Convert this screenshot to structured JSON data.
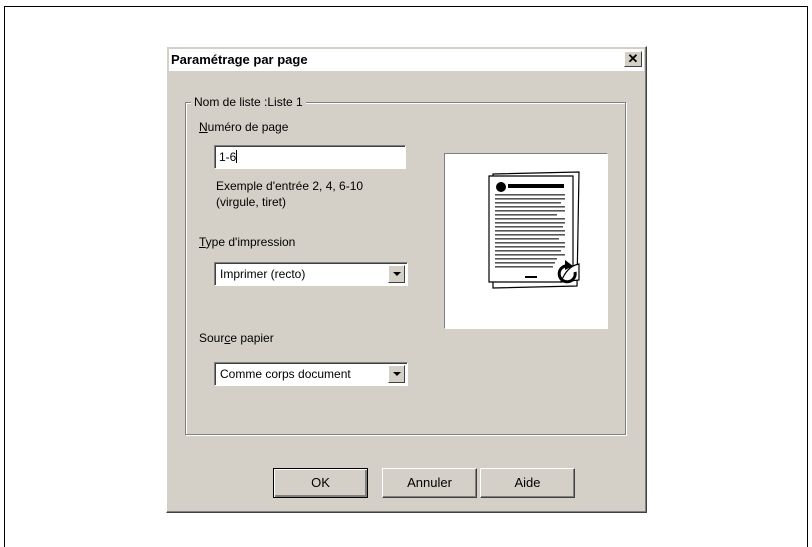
{
  "dialog": {
    "title": "Paramétrage par page",
    "close_label": "✕"
  },
  "group": {
    "legend": "Nom de liste :Liste 1"
  },
  "page_number": {
    "label_first": "N",
    "label_rest": "uméro de page",
    "value": "1-6",
    "hint_line1": "Exemple d'entrée 2, 4, 6-10",
    "hint_line2": "(virgule, tiret)"
  },
  "print_type": {
    "label_first": "T",
    "label_rest": "ype d'impression",
    "selected": "Imprimer (recto)"
  },
  "paper_source": {
    "label_pre": "Sour",
    "label_underlined": "c",
    "label_post": "e papier",
    "selected": "Comme corps document"
  },
  "buttons": {
    "ok": "OK",
    "cancel": "Annuler",
    "help": "Aide"
  },
  "preview": {
    "icon": "simplex-page-preview-icon"
  }
}
